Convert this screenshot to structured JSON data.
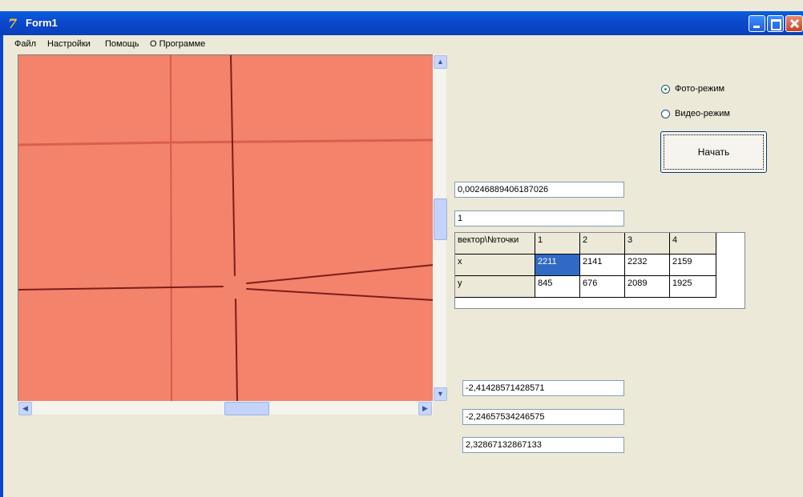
{
  "window": {
    "title": "Form1"
  },
  "menu": [
    "Файл",
    "Настройки",
    "Помощь",
    "О Программе"
  ],
  "mode": {
    "photo_label": "Фото-режим",
    "video_label": "Видео-режим",
    "selected": "photo"
  },
  "start_button": "Начать",
  "fields": {
    "top1": "0,00246889406187026",
    "top2": "1",
    "bottom1": "-2,41428571428571",
    "bottom2": "-2,24657534246575",
    "bottom3": "2,32867132867133"
  },
  "table": {
    "header": [
      "вектор\\№точки",
      "1",
      "2",
      "3",
      "4"
    ],
    "rows": [
      [
        "x",
        "2211",
        "2141",
        "2232",
        "2159"
      ],
      [
        "y",
        "845",
        "676",
        "2089",
        "1925"
      ]
    ],
    "selected_cell": "x-1"
  },
  "icons": {
    "app": "delphi-app-icon",
    "scroll_up": "arrow-up-icon",
    "scroll_down": "arrow-down-icon",
    "scroll_left": "arrow-left-icon",
    "scroll_right": "arrow-right-icon"
  },
  "colors": {
    "titlebar": "#0b49cd",
    "image_bg": "#f3836a",
    "selection": "#316ac5",
    "form_bg": "#ece9d8"
  }
}
